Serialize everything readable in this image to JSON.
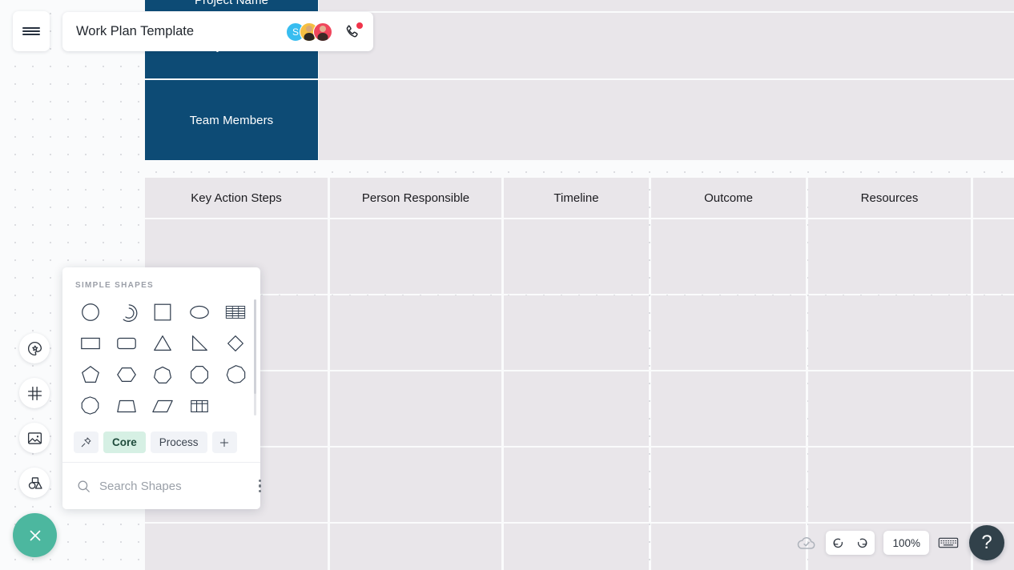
{
  "window": {
    "title": "Work Plan Template"
  },
  "topbar": {
    "menu_icon": "hamburger-menu-icon",
    "phone_icon": "phone-call-icon",
    "collaborators": [
      {
        "label": "S",
        "kind": "initial",
        "color": "#38bdf0"
      },
      {
        "label": "",
        "kind": "photo",
        "color": "#f5bf42"
      },
      {
        "label": "",
        "kind": "photo",
        "color": "#f0465c"
      }
    ]
  },
  "rail": {
    "items": [
      {
        "name": "theme-palette-icon",
        "label": "Theme"
      },
      {
        "name": "frame-icon",
        "label": "Frame"
      },
      {
        "name": "image-icon",
        "label": "Image"
      },
      {
        "name": "shapes-icon",
        "label": "Shapes"
      }
    ],
    "fab": {
      "name": "close-icon",
      "label": "Close",
      "color": "#4cb79f"
    }
  },
  "shapes_panel": {
    "header": "SIMPLE SHAPES",
    "shapes": [
      "circle",
      "arc",
      "square",
      "ellipse",
      "striped-table",
      "rectangle",
      "rounded-rectangle",
      "triangle",
      "right-triangle",
      "diamond",
      "pentagon",
      "hexagon",
      "heptagon",
      "octagon",
      "nonagon",
      "decagon",
      "trapezoid",
      "parallelogram",
      "table-grid"
    ],
    "categories": [
      {
        "label": "",
        "icon": "pin-icon",
        "active": false
      },
      {
        "label": "Core",
        "icon": "",
        "active": true
      },
      {
        "label": "Process",
        "icon": "",
        "active": false
      },
      {
        "label": "+",
        "icon": "plus-icon",
        "active": false
      }
    ],
    "search": {
      "placeholder": "Search Shapes",
      "value": "",
      "icon": "search-icon"
    },
    "more_icon": "kebab-menu-icon"
  },
  "board": {
    "blue_boxes": [
      {
        "label": "Project Name"
      },
      {
        "label": "Project Goal"
      },
      {
        "label": "Team Members"
      }
    ],
    "table": {
      "headers": [
        "Key Action Steps",
        "Person Responsible",
        "Timeline",
        "Outcome",
        "Resources",
        ""
      ],
      "rows": [
        [
          "",
          "",
          "",
          "",
          "",
          ""
        ],
        [
          "",
          "",
          "",
          "",
          "",
          ""
        ],
        [
          "",
          "",
          "",
          "",
          "",
          ""
        ],
        [
          "",
          "",
          "",
          "",
          "",
          ""
        ],
        [
          "",
          "",
          "",
          "",
          "",
          ""
        ]
      ]
    }
  },
  "bottom_toolbar": {
    "cloud_icon": "cloud-saved-icon",
    "undo_icon": "undo-arrow-icon",
    "redo_icon": "redo-arrow-icon",
    "zoom_level": "100%",
    "keyboard_icon": "keyboard-shortcuts-icon",
    "help_label": "?"
  },
  "colors": {
    "brand_blue": "#0d4b75",
    "cell_grey": "#e9e6ea",
    "accent_green": "#4cb79f",
    "help_dark": "#31414a"
  }
}
